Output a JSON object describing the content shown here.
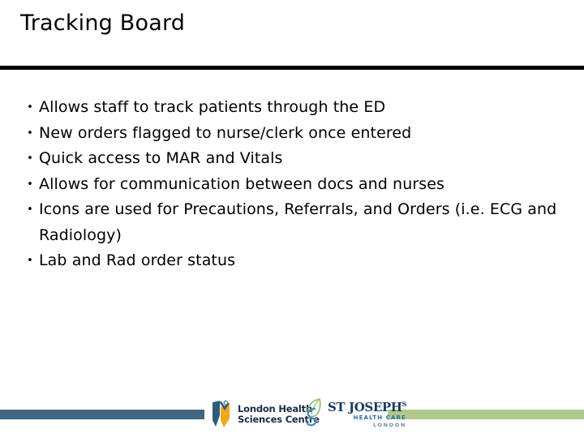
{
  "slide": {
    "title": "Tracking Board",
    "background_color": "#FFFFFF",
    "rule_color": "#000000"
  },
  "bullets": [
    {
      "marker": "•",
      "text": "Allows staff to track patients through the ED"
    },
    {
      "marker": "•",
      "text": "New orders flagged to nurse/clerk once entered"
    },
    {
      "marker": "•",
      "text": "Quick access to MAR and Vitals"
    },
    {
      "marker": "•",
      "text": "Allows for communication between docs and nurses"
    },
    {
      "marker": "•",
      "text": "Icons are used for Precautions, Referrals, and Orders (i.e. ECG and Radiology)"
    },
    {
      "marker": "•",
      "text": "Lab and Rad order status"
    }
  ],
  "footer": {
    "bar_left_color": "#3E6781",
    "bar_right_color": "#AFC98A",
    "logo_lhsc": {
      "icon_name": "lhsc-logo-icon",
      "line1": "London Health",
      "line2": "Sciences Centre",
      "mark_blue": "#2E5C7A",
      "mark_gold": "#F0A81E"
    },
    "logo_stjoseph": {
      "icon_name": "st-josephs-leaf-icon",
      "line1": "ST JOSEPH",
      "line1_suffix": "S",
      "line2": "HEALTH CARE",
      "line3": "LONDON",
      "mark_green": "#8FBF6A",
      "mark_blue": "#4F8FC0"
    }
  }
}
